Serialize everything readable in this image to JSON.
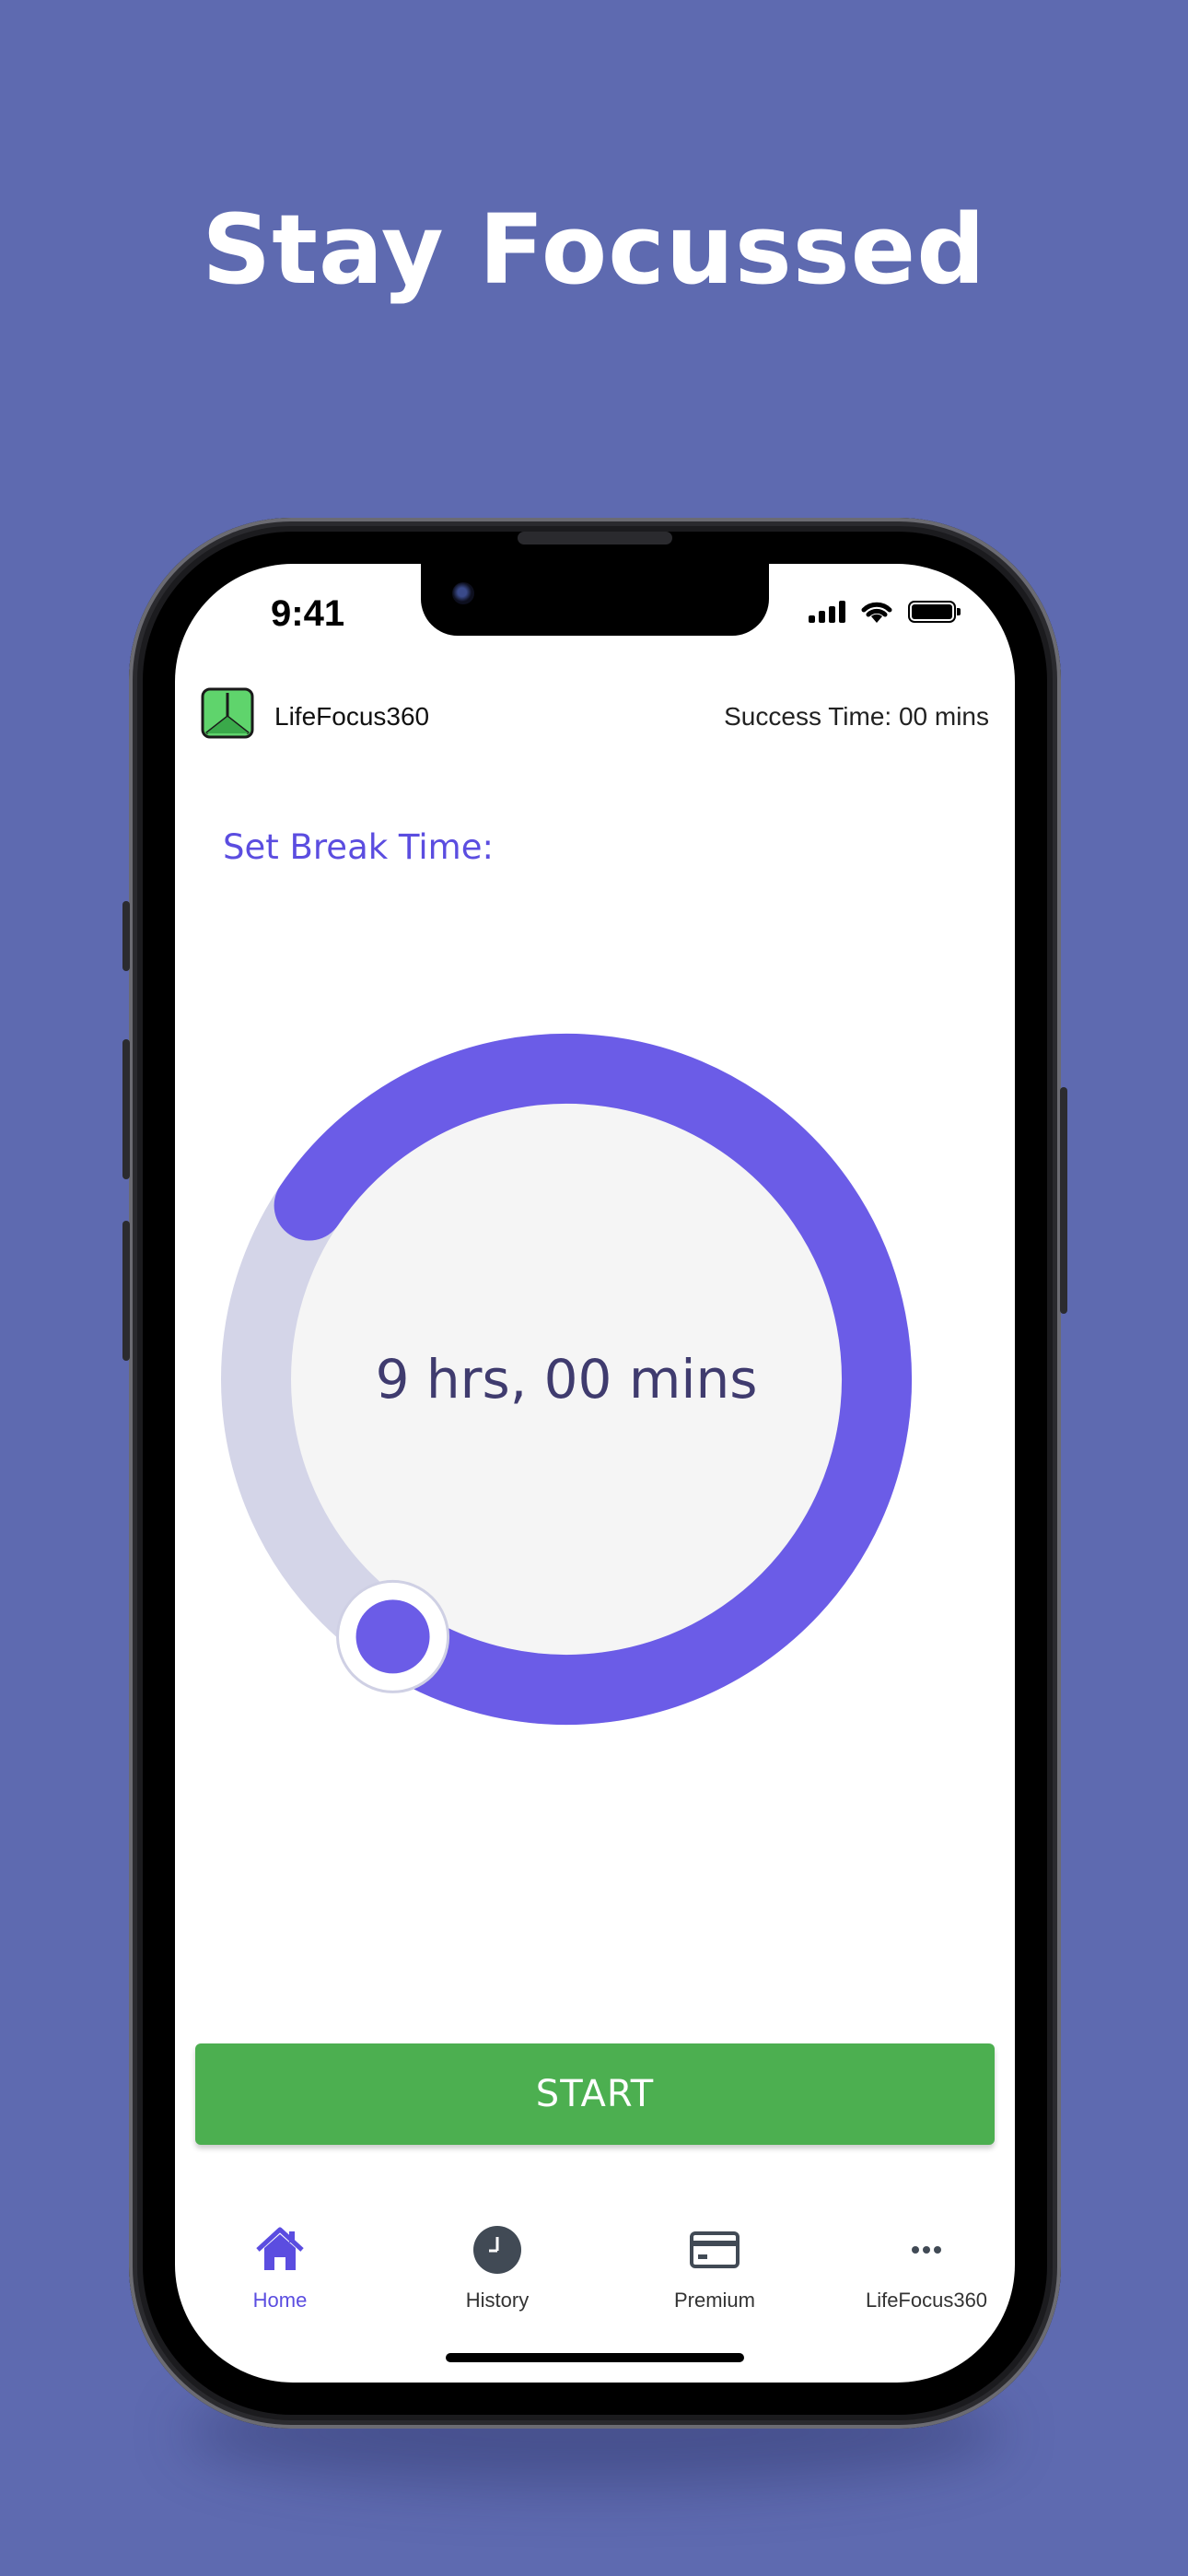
{
  "headline": "Stay Focussed",
  "status_bar": {
    "time": "9:41"
  },
  "app_header": {
    "app_name": "LifeFocus360",
    "success_time": "Success Time: 00 mins"
  },
  "break_section": {
    "label": "Set Break Time:"
  },
  "dial": {
    "value_text": "9 hrs, 00 mins",
    "fraction": 0.75,
    "accent_color": "#6b5ce7",
    "track_color": "#d4d5e8"
  },
  "start_button": {
    "label": "START",
    "color": "#4caf50"
  },
  "tabs": [
    {
      "label": "Home",
      "icon": "home-icon",
      "active": true
    },
    {
      "label": "History",
      "icon": "clock-icon",
      "active": false
    },
    {
      "label": "Premium",
      "icon": "credit-card-icon",
      "active": false
    },
    {
      "label": "LifeFocus360",
      "icon": "more-dots-icon",
      "active": false
    }
  ],
  "colors": {
    "background": "#5e6ab0",
    "accent": "#6b5ce7",
    "label": "#5b4de0"
  }
}
